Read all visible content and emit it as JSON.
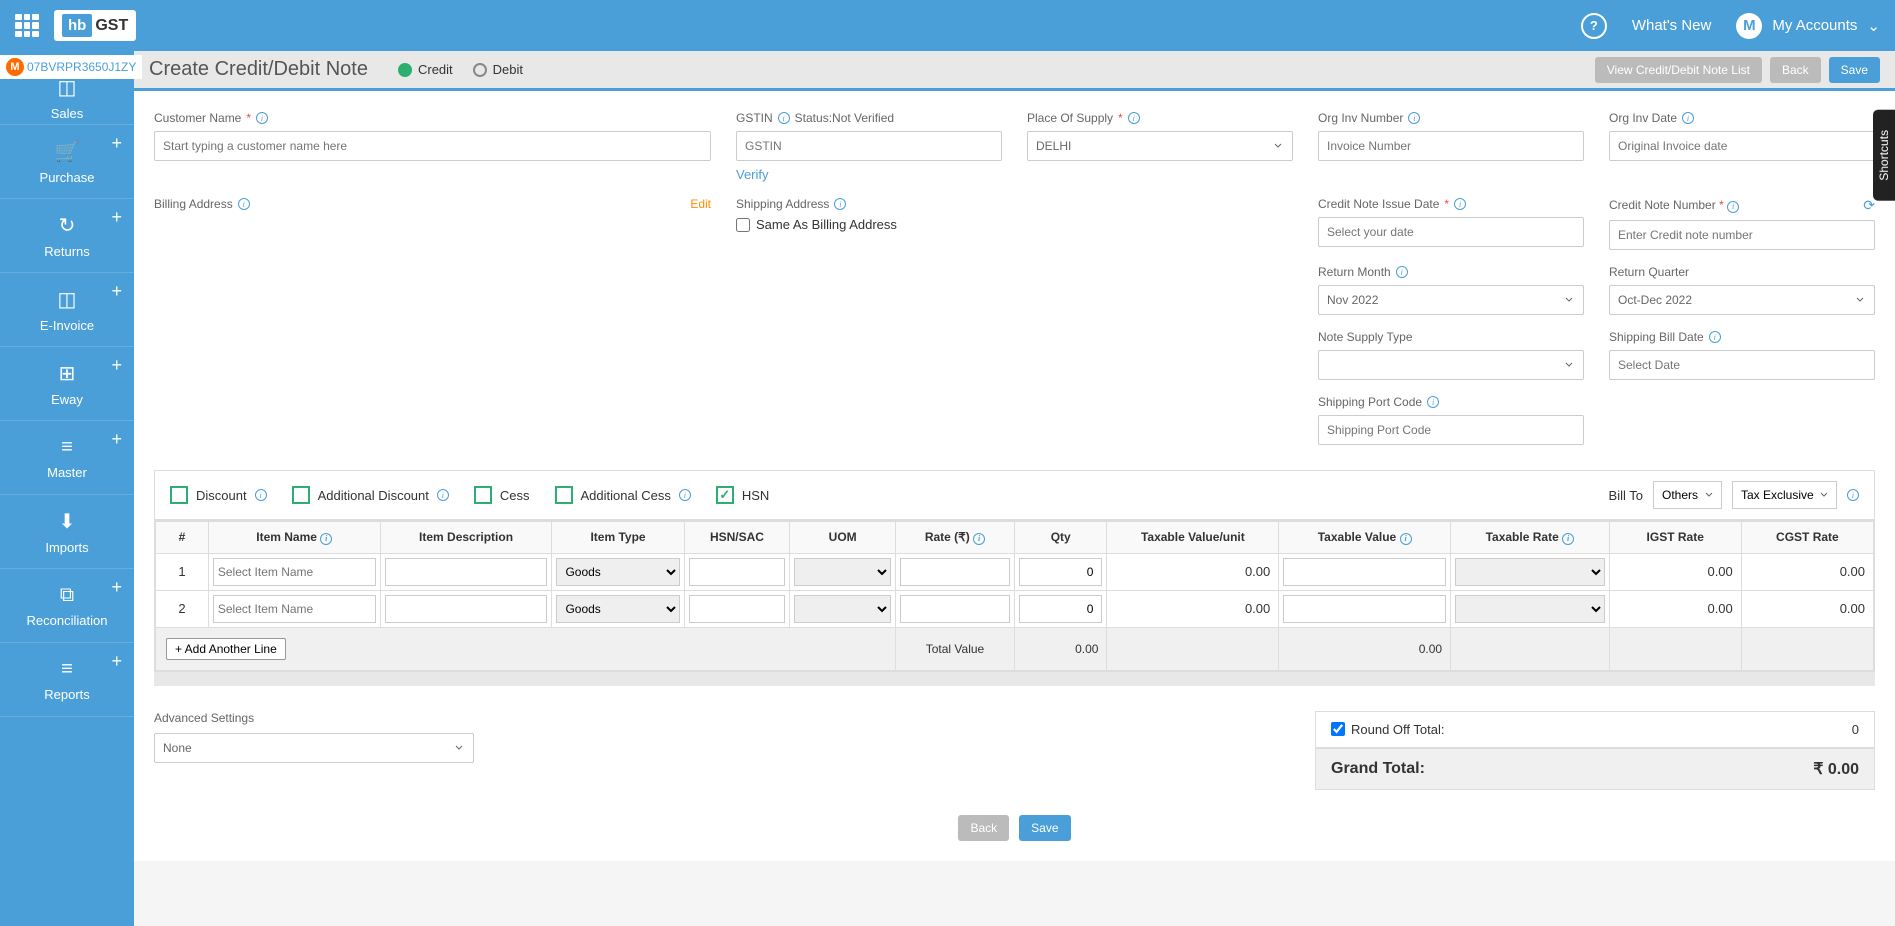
{
  "header": {
    "logo_hb": "hb",
    "logo_gst": "GST",
    "whats_new": "What's New",
    "my_accounts": "My Accounts",
    "account_initial": "M",
    "help": "?"
  },
  "gstin_badge": {
    "initial": "M",
    "value": "07BVRPR3650J1ZY"
  },
  "sidebar": {
    "items": [
      {
        "label": "Sales",
        "icon": "📊"
      },
      {
        "label": "Purchase",
        "icon": "🛒"
      },
      {
        "label": "Returns",
        "icon": "↻"
      },
      {
        "label": "E-Invoice",
        "icon": "📊"
      },
      {
        "label": "Eway",
        "icon": "⊞"
      },
      {
        "label": "Master",
        "icon": "≡"
      },
      {
        "label": "Imports",
        "icon": "⬇"
      },
      {
        "label": "Reconciliation",
        "icon": "⧉"
      },
      {
        "label": "Reports",
        "icon": "≡"
      }
    ]
  },
  "page": {
    "title": "Create Credit/Debit Note",
    "radio_credit": "Credit",
    "radio_debit": "Debit",
    "btn_view_list": "View Credit/Debit Note List",
    "btn_back": "Back",
    "btn_save": "Save"
  },
  "form": {
    "customer_name_label": "Customer Name",
    "customer_name_placeholder": "Start typing a customer name here",
    "gstin_label": "GSTIN",
    "gstin_status": "Status:Not Verified",
    "gstin_placeholder": "GSTIN",
    "verify": "Verify",
    "place_of_supply_label": "Place Of Supply",
    "place_of_supply_value": "DELHI",
    "org_inv_number_label": "Org Inv Number",
    "org_inv_number_placeholder": "Invoice Number",
    "org_inv_date_label": "Org Inv Date",
    "org_inv_date_placeholder": "Original Invoice date",
    "billing_address_label": "Billing Address",
    "edit": "Edit",
    "shipping_address_label": "Shipping Address",
    "same_as_billing": "Same As Billing Address",
    "credit_note_issue_date_label": "Credit Note Issue Date",
    "credit_note_issue_date_placeholder": "Select your date",
    "credit_note_number_label": "Credit Note Number",
    "credit_note_number_placeholder": "Enter Credit note number",
    "return_month_label": "Return Month",
    "return_month_value": "Nov 2022",
    "return_quarter_label": "Return Quarter",
    "return_quarter_value": "Oct-Dec 2022",
    "note_supply_type_label": "Note Supply Type",
    "shipping_bill_date_label": "Shipping Bill Date",
    "shipping_bill_date_placeholder": "Select Date",
    "shipping_port_code_label": "Shipping Port Code",
    "shipping_port_code_placeholder": "Shipping Port Code"
  },
  "options": {
    "discount": "Discount",
    "additional_discount": "Additional Discount",
    "cess": "Cess",
    "additional_cess": "Additional Cess",
    "hsn": "HSN",
    "bill_to": "Bill To",
    "bill_to_value": "Others",
    "tax_mode": "Tax Exclusive"
  },
  "table": {
    "headers": {
      "num": "#",
      "item_name": "Item Name",
      "item_description": "Item Description",
      "item_type": "Item Type",
      "hsn_sac": "HSN/SAC",
      "uom": "UOM",
      "rate": "Rate (₹)",
      "qty": "Qty",
      "taxable_value_unit": "Taxable Value/unit",
      "taxable_value": "Taxable Value",
      "taxable_rate": "Taxable Rate",
      "igst_rate": "IGST Rate",
      "cgst_rate": "CGST Rate"
    },
    "rows": [
      {
        "num": "1",
        "item_name_placeholder": "Select Item Name",
        "item_type": "Goods",
        "qty": "0",
        "taxable_value_unit": "0.00",
        "igst_rate": "0.00",
        "cgst_rate": "0.00"
      },
      {
        "num": "2",
        "item_name_placeholder": "Select Item Name",
        "item_type": "Goods",
        "qty": "0",
        "taxable_value_unit": "0.00",
        "igst_rate": "0.00",
        "cgst_rate": "0.00"
      }
    ],
    "add_another": "+ Add Another Line",
    "total_value_label": "Total Value",
    "total_value": "0.00",
    "total_taxable": "0.00"
  },
  "advanced": {
    "label": "Advanced Settings",
    "value": "None"
  },
  "totals": {
    "round_off_label": "Round Off Total:",
    "round_off_value": "0",
    "grand_total_label": "Grand Total:",
    "grand_total_value": "₹ 0.00"
  },
  "shortcuts": "Shortcuts"
}
